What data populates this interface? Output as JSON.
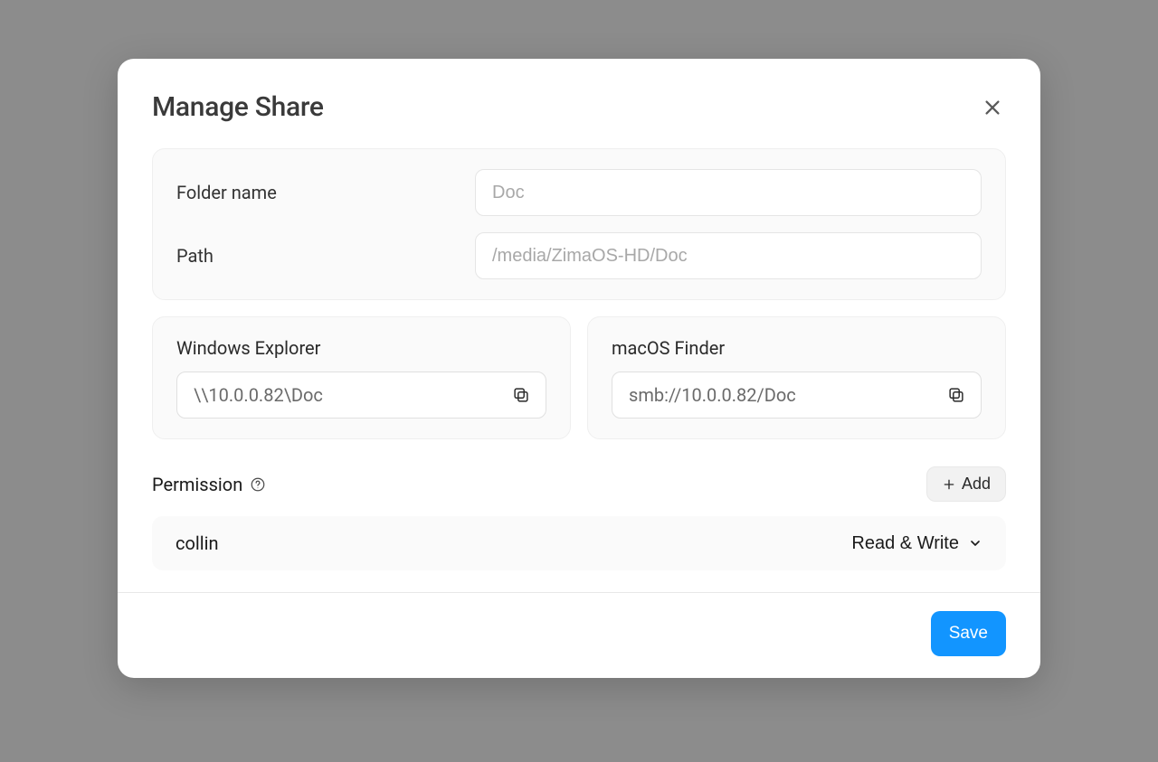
{
  "dialog": {
    "title": "Manage Share",
    "folder_name_label": "Folder name",
    "folder_name_value": "Doc",
    "path_label": "Path",
    "path_value": "/media/ZimaOS-HD/Doc",
    "windows": {
      "title": "Windows Explorer",
      "value": "\\\\10.0.0.82\\Doc"
    },
    "macos": {
      "title": "macOS Finder",
      "value": "smb://10.0.0.82/Doc"
    },
    "permission": {
      "label": "Permission",
      "add_label": "Add",
      "users": [
        {
          "name": "collin",
          "level": "Read & Write"
        }
      ]
    },
    "save_label": "Save"
  }
}
